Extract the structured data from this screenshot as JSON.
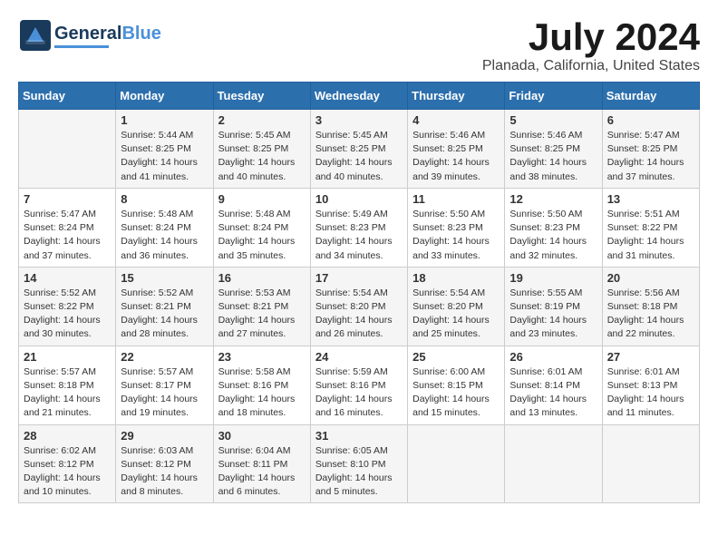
{
  "logo": {
    "line1": "General",
    "line2": "Blue"
  },
  "title": "July 2024",
  "location": "Planada, California, United States",
  "weekdays": [
    "Sunday",
    "Monday",
    "Tuesday",
    "Wednesday",
    "Thursday",
    "Friday",
    "Saturday"
  ],
  "weeks": [
    [
      {
        "day": "",
        "info": ""
      },
      {
        "day": "1",
        "info": "Sunrise: 5:44 AM\nSunset: 8:25 PM\nDaylight: 14 hours\nand 41 minutes."
      },
      {
        "day": "2",
        "info": "Sunrise: 5:45 AM\nSunset: 8:25 PM\nDaylight: 14 hours\nand 40 minutes."
      },
      {
        "day": "3",
        "info": "Sunrise: 5:45 AM\nSunset: 8:25 PM\nDaylight: 14 hours\nand 40 minutes."
      },
      {
        "day": "4",
        "info": "Sunrise: 5:46 AM\nSunset: 8:25 PM\nDaylight: 14 hours\nand 39 minutes."
      },
      {
        "day": "5",
        "info": "Sunrise: 5:46 AM\nSunset: 8:25 PM\nDaylight: 14 hours\nand 38 minutes."
      },
      {
        "day": "6",
        "info": "Sunrise: 5:47 AM\nSunset: 8:25 PM\nDaylight: 14 hours\nand 37 minutes."
      }
    ],
    [
      {
        "day": "7",
        "info": "Sunrise: 5:47 AM\nSunset: 8:24 PM\nDaylight: 14 hours\nand 37 minutes."
      },
      {
        "day": "8",
        "info": "Sunrise: 5:48 AM\nSunset: 8:24 PM\nDaylight: 14 hours\nand 36 minutes."
      },
      {
        "day": "9",
        "info": "Sunrise: 5:48 AM\nSunset: 8:24 PM\nDaylight: 14 hours\nand 35 minutes."
      },
      {
        "day": "10",
        "info": "Sunrise: 5:49 AM\nSunset: 8:23 PM\nDaylight: 14 hours\nand 34 minutes."
      },
      {
        "day": "11",
        "info": "Sunrise: 5:50 AM\nSunset: 8:23 PM\nDaylight: 14 hours\nand 33 minutes."
      },
      {
        "day": "12",
        "info": "Sunrise: 5:50 AM\nSunset: 8:23 PM\nDaylight: 14 hours\nand 32 minutes."
      },
      {
        "day": "13",
        "info": "Sunrise: 5:51 AM\nSunset: 8:22 PM\nDaylight: 14 hours\nand 31 minutes."
      }
    ],
    [
      {
        "day": "14",
        "info": "Sunrise: 5:52 AM\nSunset: 8:22 PM\nDaylight: 14 hours\nand 30 minutes."
      },
      {
        "day": "15",
        "info": "Sunrise: 5:52 AM\nSunset: 8:21 PM\nDaylight: 14 hours\nand 28 minutes."
      },
      {
        "day": "16",
        "info": "Sunrise: 5:53 AM\nSunset: 8:21 PM\nDaylight: 14 hours\nand 27 minutes."
      },
      {
        "day": "17",
        "info": "Sunrise: 5:54 AM\nSunset: 8:20 PM\nDaylight: 14 hours\nand 26 minutes."
      },
      {
        "day": "18",
        "info": "Sunrise: 5:54 AM\nSunset: 8:20 PM\nDaylight: 14 hours\nand 25 minutes."
      },
      {
        "day": "19",
        "info": "Sunrise: 5:55 AM\nSunset: 8:19 PM\nDaylight: 14 hours\nand 23 minutes."
      },
      {
        "day": "20",
        "info": "Sunrise: 5:56 AM\nSunset: 8:18 PM\nDaylight: 14 hours\nand 22 minutes."
      }
    ],
    [
      {
        "day": "21",
        "info": "Sunrise: 5:57 AM\nSunset: 8:18 PM\nDaylight: 14 hours\nand 21 minutes."
      },
      {
        "day": "22",
        "info": "Sunrise: 5:57 AM\nSunset: 8:17 PM\nDaylight: 14 hours\nand 19 minutes."
      },
      {
        "day": "23",
        "info": "Sunrise: 5:58 AM\nSunset: 8:16 PM\nDaylight: 14 hours\nand 18 minutes."
      },
      {
        "day": "24",
        "info": "Sunrise: 5:59 AM\nSunset: 8:16 PM\nDaylight: 14 hours\nand 16 minutes."
      },
      {
        "day": "25",
        "info": "Sunrise: 6:00 AM\nSunset: 8:15 PM\nDaylight: 14 hours\nand 15 minutes."
      },
      {
        "day": "26",
        "info": "Sunrise: 6:01 AM\nSunset: 8:14 PM\nDaylight: 14 hours\nand 13 minutes."
      },
      {
        "day": "27",
        "info": "Sunrise: 6:01 AM\nSunset: 8:13 PM\nDaylight: 14 hours\nand 11 minutes."
      }
    ],
    [
      {
        "day": "28",
        "info": "Sunrise: 6:02 AM\nSunset: 8:12 PM\nDaylight: 14 hours\nand 10 minutes."
      },
      {
        "day": "29",
        "info": "Sunrise: 6:03 AM\nSunset: 8:12 PM\nDaylight: 14 hours\nand 8 minutes."
      },
      {
        "day": "30",
        "info": "Sunrise: 6:04 AM\nSunset: 8:11 PM\nDaylight: 14 hours\nand 6 minutes."
      },
      {
        "day": "31",
        "info": "Sunrise: 6:05 AM\nSunset: 8:10 PM\nDaylight: 14 hours\nand 5 minutes."
      },
      {
        "day": "",
        "info": ""
      },
      {
        "day": "",
        "info": ""
      },
      {
        "day": "",
        "info": ""
      }
    ]
  ]
}
